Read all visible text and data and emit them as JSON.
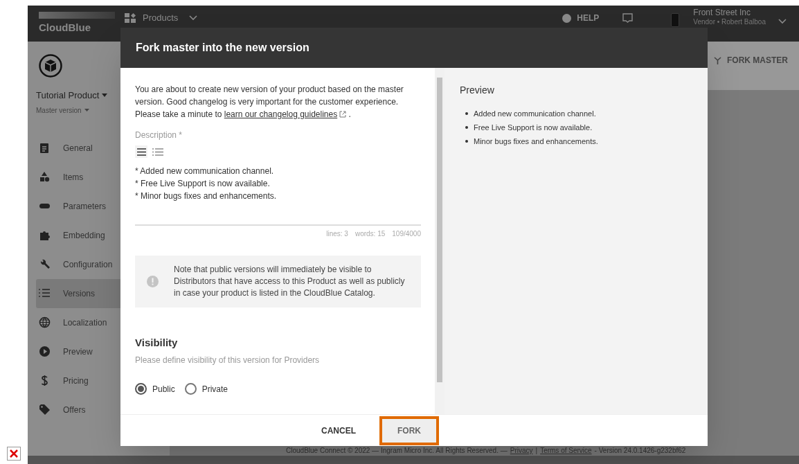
{
  "header": {
    "logo": "CloudBlue",
    "products_menu": "Products",
    "help": "HELP",
    "account": {
      "company": "Front Street Inc",
      "role": "Vendor • Robert Balboa"
    }
  },
  "sidebar": {
    "product_name": "Tutorial Product",
    "version": "Master version",
    "items": [
      {
        "label": "General",
        "selected": false
      },
      {
        "label": "Items",
        "selected": false
      },
      {
        "label": "Parameters",
        "selected": false
      },
      {
        "label": "Embedding",
        "selected": false
      },
      {
        "label": "Configuration",
        "selected": false
      },
      {
        "label": "Versions",
        "selected": true
      },
      {
        "label": "Localization",
        "selected": false
      },
      {
        "label": "Preview",
        "selected": false
      },
      {
        "label": "Pricing",
        "selected": false
      },
      {
        "label": "Offers",
        "selected": false
      }
    ]
  },
  "page_action": "FORK MASTER",
  "footer": {
    "copyright": "CloudBlue Connect © 2022 — Ingram Micro Inc. All Rights Reserved. —",
    "links": [
      "Privacy",
      "Terms of Service"
    ],
    "separator": "|",
    "version": "- Version 24.0.1426-g232bf62"
  },
  "dialog": {
    "title": "Fork master into the new version",
    "intro": "You are about to create new version of your product based on the master version. Good changelog is very important for the customer experience. Please take a minute to",
    "intro_link": "learn our changelog guidelines",
    "intro_end": ".",
    "description": {
      "label": "Description *",
      "lines": [
        "* Added new communication channel.",
        "* Free Live Support is now available.",
        "* Minor bugs fixes and enhancements."
      ],
      "stats": [
        "lines: 3",
        "words: 15",
        "109/4000"
      ]
    },
    "note": "Note that public versions will immediately be visible to Distributors that have access to this Product as well as publicly in case your product is listed in the CloudBlue Catalog.",
    "visibility": {
      "title": "Visibility",
      "hint": "Please define visibility of this version for Providers",
      "options": [
        {
          "label": "Public",
          "selected": true
        },
        {
          "label": "Private",
          "selected": false
        }
      ]
    },
    "preview": {
      "title": "Preview",
      "items": [
        "Added new communication channel.",
        "Free Live Support is now available.",
        "Minor bugs fixes and enhancements."
      ]
    },
    "buttons": [
      {
        "label": "CANCEL",
        "kind": "text"
      },
      {
        "label": "FORK",
        "kind": "outlined"
      }
    ]
  }
}
